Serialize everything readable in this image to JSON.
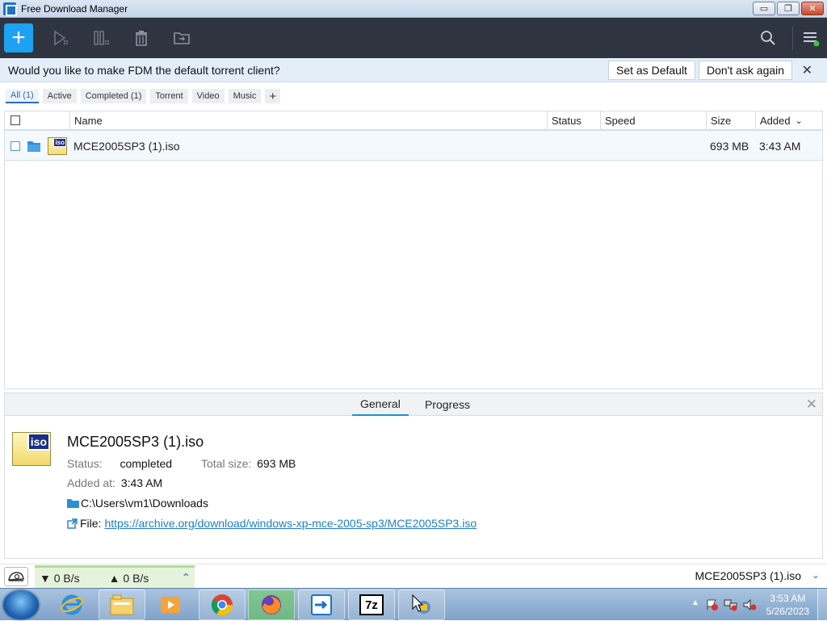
{
  "window": {
    "title": "Free Download Manager",
    "controls": {
      "minimize": "▭",
      "maximize": "❐",
      "close": "✕"
    }
  },
  "toolbar": {
    "add_label": "+",
    "icons": [
      "play-icon",
      "pause-icon",
      "trash-icon",
      "move-folder-icon",
      "search-icon",
      "hamburger-menu-icon"
    ]
  },
  "notification": {
    "message": "Would you like to make FDM the default torrent client?",
    "set_default": "Set as Default",
    "dont_ask": "Don't ask again",
    "close": "✕"
  },
  "filters": [
    {
      "label": "All (1)",
      "active": true
    },
    {
      "label": "Active",
      "active": false
    },
    {
      "label": "Completed (1)",
      "active": false
    },
    {
      "label": "Torrent",
      "active": false
    },
    {
      "label": "Video",
      "active": false
    },
    {
      "label": "Music",
      "active": false
    }
  ],
  "filters_add": "+",
  "table": {
    "columns": {
      "name": "Name",
      "status": "Status",
      "speed": "Speed",
      "size": "Size",
      "added": "Added",
      "sort_indicator": "⌄"
    },
    "rows": [
      {
        "name": "MCE2005SP3 (1).iso",
        "status": "",
        "speed": "",
        "size": "693 MB",
        "added": "3:43 AM",
        "icon_label": "iso"
      }
    ]
  },
  "details": {
    "tabs": {
      "general": "General",
      "progress": "Progress"
    },
    "close": "✕",
    "icon_label": "iso",
    "file_name": "MCE2005SP3 (1).iso",
    "status_key": "Status:",
    "status_val": "completed",
    "total_key": "Total size:",
    "total_val": "693 MB",
    "added_key": "Added at:",
    "added_val": "3:43 AM",
    "folder": "C:\\Users\\vm1\\Downloads",
    "file_key": "File:",
    "file_url": "https://archive.org/download/windows-xp-mce-2005-sp3/MCE2005SP3.iso"
  },
  "statusbar": {
    "download_speed": "▼ 0 B/s",
    "upload_speed": "▲ 0 B/s",
    "expand": "⌃",
    "current_file": "MCE2005SP3 (1).iso",
    "chevron": "⌄"
  },
  "taskbar": {
    "apps": [
      "internet-explorer-icon",
      "file-explorer-icon",
      "media-player-icon",
      "chrome-icon",
      "firefox-icon",
      "fdm-icon",
      "7zip-icon",
      "network-tool-icon"
    ],
    "sevenzip_label": "7z",
    "tray_arrow": "▲",
    "time": "3:53 AM",
    "date": "5/26/2023"
  },
  "colors": {
    "toolbar_bg": "#2e3440",
    "accent": "#1da1f2",
    "link": "#1c7fc4",
    "notify_bg": "#e4eef8"
  }
}
